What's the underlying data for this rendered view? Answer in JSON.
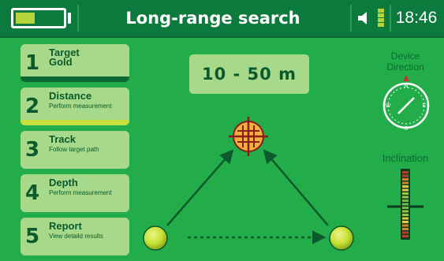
{
  "header": {
    "title": "Long-range search",
    "time": "18:46",
    "battery_level": 0.42
  },
  "steps": [
    {
      "number": "1",
      "title": "Target",
      "subtitle": "Gold",
      "subtitle_style": "bold",
      "bar_color": "#0b6a34"
    },
    {
      "number": "2",
      "title": "Distance",
      "subtitle": "Perform measurement",
      "subtitle_style": "small",
      "bar_color": "#c6df3a"
    },
    {
      "number": "3",
      "title": "Track",
      "subtitle": "Follow target path",
      "subtitle_style": "small",
      "bar_color": ""
    },
    {
      "number": "4",
      "title": "Depth",
      "subtitle": "Perform measurement",
      "subtitle_style": "small",
      "bar_color": ""
    },
    {
      "number": "5",
      "title": "Report",
      "subtitle": "View detaild results",
      "subtitle_style": "small",
      "bar_color": ""
    }
  ],
  "distance_display": {
    "text": "10 - 50 m"
  },
  "compass": {
    "label_line1": "Device",
    "label_line2": "Direction",
    "letters": {
      "north": "N",
      "east": "E",
      "south": "S",
      "west": "W"
    }
  },
  "inclination": {
    "label": "Inclination"
  },
  "icons": {
    "speaker": "speaker-icon",
    "signal": "signal-strength-icon",
    "battery": "battery-icon",
    "target": "crosshair-target-icon"
  },
  "colors": {
    "background": "#22ad4a",
    "header": "#0b7a3c",
    "panel": "#a7d98a",
    "dark_green": "#0a5a2c",
    "accent_yellow": "#c6df3a",
    "ball": "#c8e032",
    "target_orange": "#f3b03a",
    "target_red": "#8b1c1c"
  }
}
